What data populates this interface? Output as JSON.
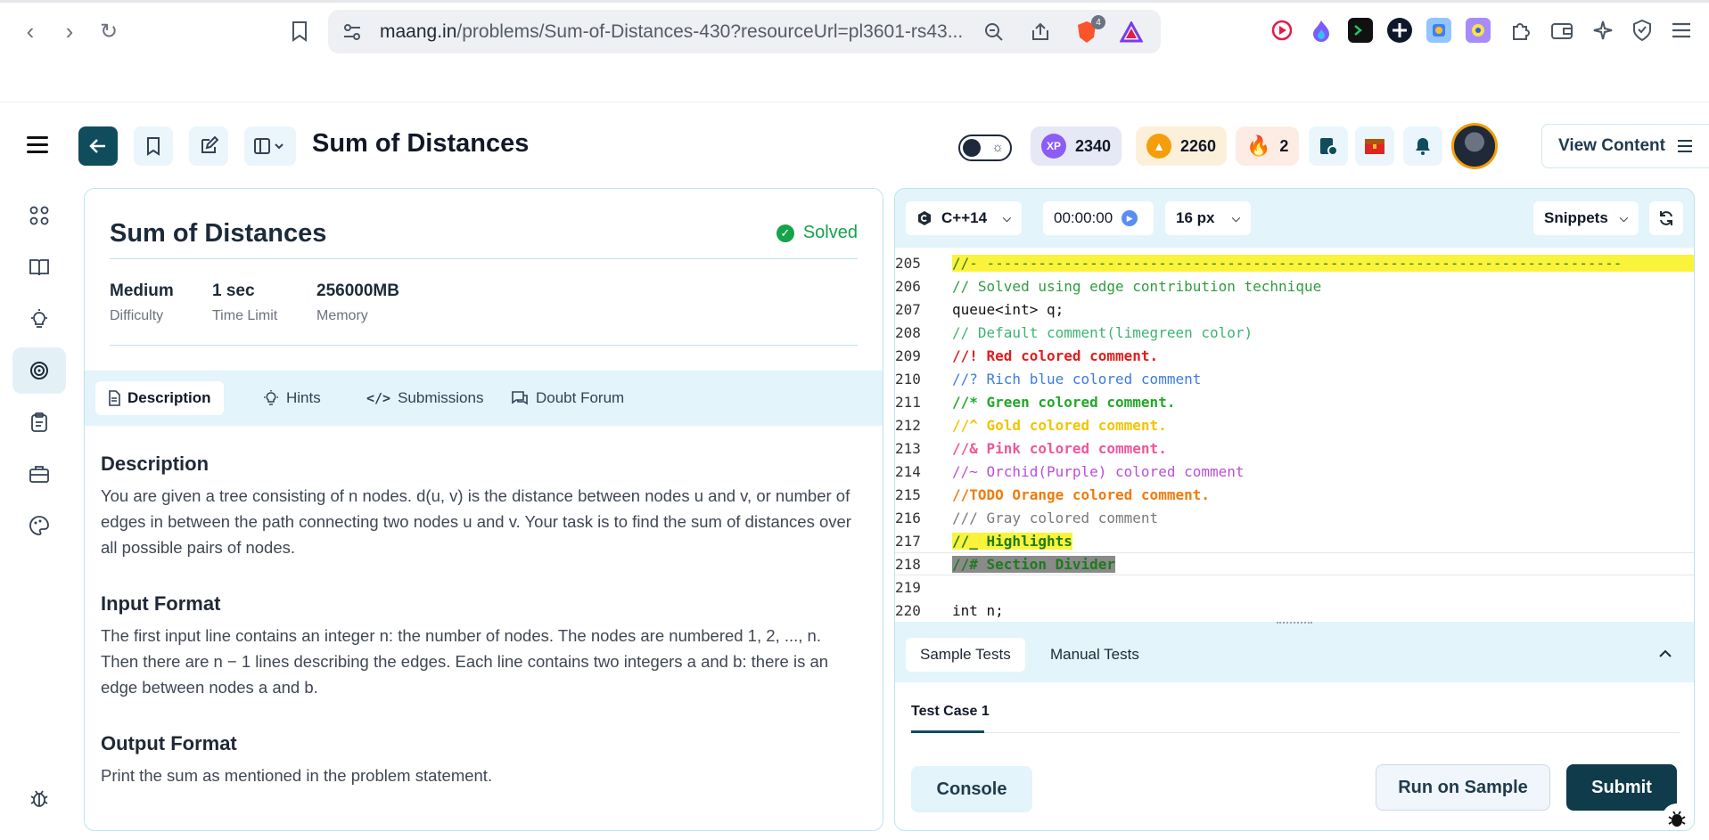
{
  "browser": {
    "url_domain": "maang.in",
    "url_path": "/problems/Sum-of-Distances-430?resourceUrl=pl3601-rs43...",
    "brave_badge": "4"
  },
  "header": {
    "title": "Sum of Distances",
    "xp_value": "2340",
    "coins_value": "2260",
    "streak_value": "2",
    "xp_badge": "XP",
    "view_content_label": "View Content"
  },
  "problem": {
    "title": "Sum of Distances",
    "status": "Solved",
    "difficulty_value": "Medium",
    "difficulty_label": "Difficulty",
    "time_value": "1 sec",
    "time_label": "Time Limit",
    "memory_value": "256000MB",
    "memory_label": "Memory",
    "tabs": [
      "Description",
      "Hints",
      "Submissions",
      "Doubt Forum"
    ],
    "description_heading": "Description",
    "description_text": "You are given a tree consisting of n nodes. d(u, v) is the distance between nodes u and v, or number of edges in between the path connecting two nodes u and v. Your task is to find the sum of distances over all possible pairs of nodes.",
    "input_heading": "Input Format",
    "input_text_1": "The first input line contains an integer n: the number of nodes. The nodes are numbered 1, 2, ..., n.",
    "input_text_2": "Then there are n − 1 lines describing the edges. Each line contains two integers a and b: there is an edge between nodes a and b.",
    "output_heading": "Output Format",
    "output_text": "Print the sum as mentioned in the problem statement."
  },
  "editor": {
    "language": "C++14",
    "timer": "00:00:00",
    "font_size": "16 px",
    "snippets_label": "Snippets",
    "lines": [
      {
        "num": "205",
        "text": "//- --------------------------------------------------------------------------",
        "color": "#2e7d32",
        "bg": "#fbf33a"
      },
      {
        "num": "206",
        "text": "// Solved using edge contribution technique",
        "color": "#2e9e3e",
        "bg": ""
      },
      {
        "num": "207",
        "text": "queue<int> q;",
        "color": "#111111",
        "bg": ""
      },
      {
        "num": "208",
        "text": "// Default comment(limegreen color)",
        "color": "#3cb371",
        "bg": ""
      },
      {
        "num": "209",
        "text": "//! Red colored comment.",
        "color": "#e11d1d",
        "bg": ""
      },
      {
        "num": "210",
        "text": "//? Rich blue colored comment",
        "color": "#3b7ddd",
        "bg": ""
      },
      {
        "num": "211",
        "text": "//* Green colored comment.",
        "color": "#22a829",
        "bg": ""
      },
      {
        "num": "212",
        "text": "//^ Gold colored comment.",
        "color": "#f2c400",
        "bg": ""
      },
      {
        "num": "213",
        "text": "//& Pink colored comment.",
        "color": "#f0569a",
        "bg": ""
      },
      {
        "num": "214",
        "text": "//~ Orchid(Purple) colored comment",
        "color": "#b94fd6",
        "bg": ""
      },
      {
        "num": "215",
        "text": "//TODO Orange colored comment.",
        "color": "#f07b0c",
        "bg": ""
      },
      {
        "num": "216",
        "text": "/// Gray colored comment",
        "color": "#7a7a7a",
        "bg": ""
      },
      {
        "num": "217",
        "text": "//_ Highlights",
        "color": "#1e7b1e",
        "bg": "#fbf33a"
      },
      {
        "num": "218",
        "text": "//# Section Divider",
        "color": "#1e7b1e",
        "bg": "#8a8a8a"
      },
      {
        "num": "219",
        "text": "",
        "color": "#111111",
        "bg": ""
      },
      {
        "num": "220",
        "text": "int n;",
        "color": "#111111",
        "bg": ""
      }
    ],
    "tests_tabs": [
      "Sample Tests",
      "Manual Tests"
    ],
    "case_tab": "Test Case 1",
    "console_label": "Console",
    "run_label": "Run on Sample",
    "submit_label": "Submit"
  },
  "colors": {
    "accent_dark": "#0f4c5c",
    "panel_border": "#bde3ef",
    "tab_bg": "#e3f4fa",
    "solved": "#16a34a"
  }
}
